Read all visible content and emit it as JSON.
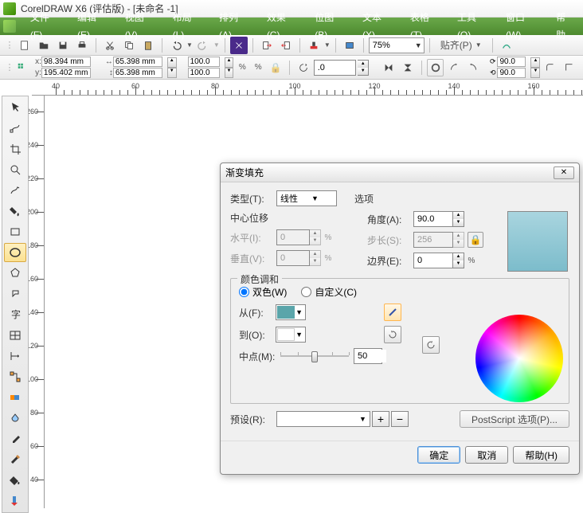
{
  "title": "CorelDRAW X6 (评估版) - [未命名 -1]",
  "menu": [
    "文件(F)",
    "编辑(E)",
    "视图(V)",
    "布局(L)",
    "排列(A)",
    "效果(C)",
    "位图(B)",
    "文本(X)",
    "表格(T)",
    "工具(O)",
    "窗口(W)",
    "帮助"
  ],
  "toolbar": {
    "zoom": "75%",
    "snap": "贴齐(P)"
  },
  "propbar": {
    "xlbl": "x:",
    "ylbl": "y:",
    "x": "98.394 mm",
    "y": "195.402 mm",
    "w": "65.398 mm",
    "h": "65.398 mm",
    "sx": "100.0",
    "sy": "100.0",
    "rot": ".0",
    "rot1": "90.0",
    "rot2": "90.0"
  },
  "ruler_h": [
    "40",
    "60",
    "80",
    "100",
    "120",
    "140",
    "160"
  ],
  "ruler_v": [
    "260",
    "240",
    "220",
    "200",
    "180",
    "160",
    "140",
    "120",
    "100",
    "80",
    "60",
    "40"
  ],
  "dialog": {
    "title": "渐变填充",
    "type_lbl": "类型(T):",
    "type_val": "线性",
    "center_lbl": "中心位移",
    "horiz_lbl": "水平(I):",
    "horiz_val": "0",
    "vert_lbl": "垂直(V):",
    "vert_val": "0",
    "pct": "%",
    "options_lbl": "选项",
    "angle_lbl": "角度(A):",
    "angle_val": "90.0",
    "steps_lbl": "步长(S):",
    "steps_val": "256",
    "edge_lbl": "边界(E):",
    "edge_val": "0",
    "blend_lbl": "颜色调和",
    "two_color": "双色(W)",
    "custom": "自定义(C)",
    "from_lbl": "从(F):",
    "to_lbl": "到(O):",
    "mid_lbl": "中点(M):",
    "mid_val": "50",
    "preset_lbl": "预设(R):",
    "postscript": "PostScript 选项(P)...",
    "ok": "确定",
    "cancel": "取消",
    "help": "帮助(H)",
    "from_color": "#5aa5aa",
    "to_color": "#ffffff"
  }
}
